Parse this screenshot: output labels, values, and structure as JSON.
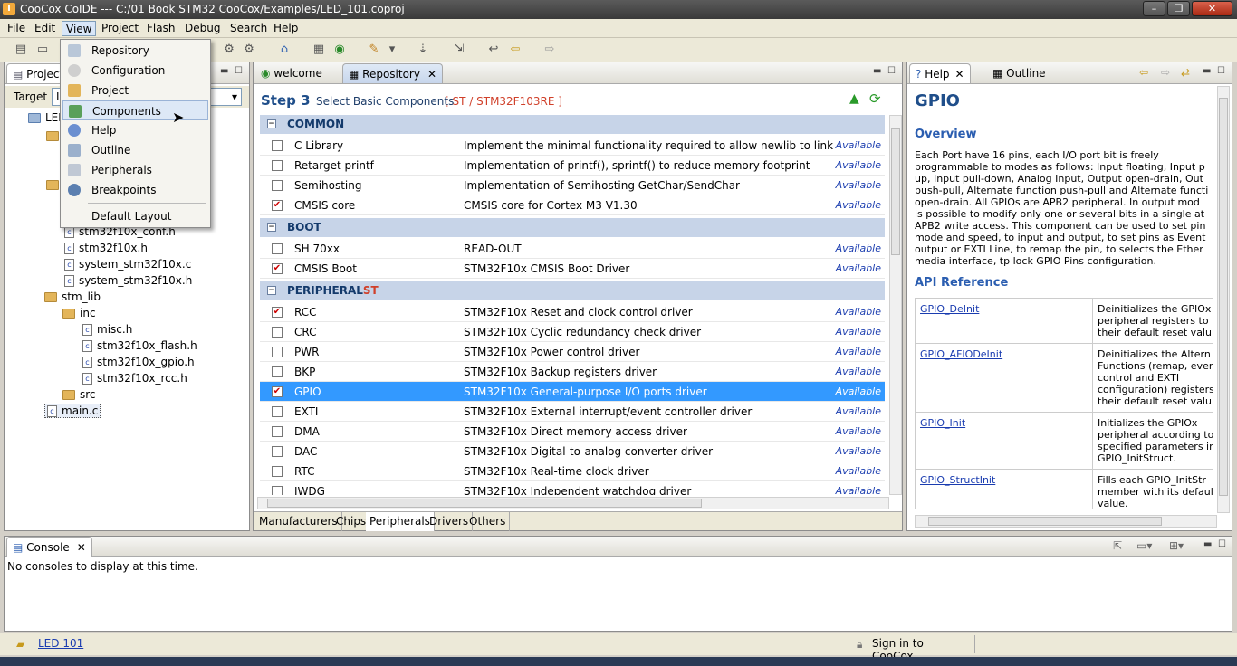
{
  "window": {
    "title": "CooCox CoIDE --- C:/01 Book STM32 CooCox/Examples/LED_101.coproj",
    "app_icon": "I"
  },
  "menubar": [
    "File",
    "Edit",
    "View",
    "Project",
    "Flash",
    "Debug",
    "Search",
    "Help"
  ],
  "view_menu": {
    "items": [
      "Repository",
      "Configuration",
      "Project",
      "Components",
      "Help",
      "Outline",
      "Peripherals",
      "Breakpoints"
    ],
    "default_layout": "Default Layout",
    "highlighted": "Components"
  },
  "project_panel": {
    "tab": "Project",
    "target_label": "Target",
    "target_value": "L",
    "root": "LED",
    "files": [
      {
        "name": "stm32f10x_conf.h",
        "kind": "file"
      },
      {
        "name": "stm32f10x.h",
        "kind": "file"
      },
      {
        "name": "system_stm32f10x.c",
        "kind": "file"
      },
      {
        "name": "system_stm32f10x.h",
        "kind": "file"
      },
      {
        "name": "stm_lib",
        "kind": "folder"
      },
      {
        "name": "inc",
        "kind": "folder"
      },
      {
        "name": "misc.h",
        "kind": "file"
      },
      {
        "name": "stm32f10x_flash.h",
        "kind": "file"
      },
      {
        "name": "stm32f10x_gpio.h",
        "kind": "file"
      },
      {
        "name": "stm32f10x_rcc.h",
        "kind": "file"
      },
      {
        "name": "src",
        "kind": "folder"
      },
      {
        "name": "main.c",
        "kind": "file"
      }
    ]
  },
  "editor": {
    "tabs": [
      "welcome",
      "Repository"
    ],
    "step": {
      "label": "Step 3",
      "text": "Select Basic Components",
      "chip": "[ ST / STM32F103RE ]"
    },
    "sections": [
      {
        "title": "COMMON",
        "suffix": "",
        "rows": [
          {
            "name": "C Library",
            "desc": "Implement the minimal functionality required to allow newlib to link",
            "status": "Available",
            "checked": false
          },
          {
            "name": "Retarget printf",
            "desc": "Implementation of printf(), sprintf() to reduce memory footprint",
            "status": "Available",
            "checked": false
          },
          {
            "name": "Semihosting",
            "desc": "Implementation of Semihosting GetChar/SendChar",
            "status": "Available",
            "checked": false
          },
          {
            "name": "CMSIS core",
            "desc": "CMSIS core for Cortex M3 V1.30",
            "status": "Available",
            "checked": true
          }
        ]
      },
      {
        "title": "BOOT",
        "suffix": "",
        "rows": [
          {
            "name": "SH 70xx",
            "desc": "READ-OUT",
            "status": "Available",
            "checked": false
          },
          {
            "name": "CMSIS Boot",
            "desc": "STM32F10x CMSIS Boot Driver",
            "status": "Available",
            "checked": true
          }
        ]
      },
      {
        "title": "PERIPHERAL",
        "suffix": "ST",
        "rows": [
          {
            "name": "RCC",
            "desc": "STM32F10x Reset and clock control driver",
            "status": "Available",
            "checked": true
          },
          {
            "name": "CRC",
            "desc": "STM32F10x Cyclic redundancy check driver",
            "status": "Available",
            "checked": false
          },
          {
            "name": "PWR",
            "desc": "STM32F10x Power control driver",
            "status": "Available",
            "checked": false
          },
          {
            "name": "BKP",
            "desc": "STM32F10x Backup registers driver",
            "status": "Available",
            "checked": false
          },
          {
            "name": "GPIO",
            "desc": "STM32F10x General-purpose I/O ports driver",
            "status": "Available",
            "checked": true,
            "selected": true
          },
          {
            "name": "EXTI",
            "desc": "STM32F10x External interrupt/event controller driver",
            "status": "Available",
            "checked": false
          },
          {
            "name": "DMA",
            "desc": "STM32F10x Direct memory access driver",
            "status": "Available",
            "checked": false
          },
          {
            "name": "DAC",
            "desc": "STM32F10x Digital-to-analog converter driver",
            "status": "Available",
            "checked": false
          },
          {
            "name": "RTC",
            "desc": "STM32F10x Real-time clock driver",
            "status": "Available",
            "checked": false
          },
          {
            "name": "IWDG",
            "desc": "STM32F10x Independent watchdog driver",
            "status": "Available",
            "checked": false
          }
        ]
      }
    ],
    "bottom_tabs": [
      "Manufacturers",
      "Chips",
      "Peripherals",
      "Drivers",
      "Others"
    ],
    "active_bottom_tab": "Peripherals"
  },
  "help_panel": {
    "tabs": [
      "Help",
      "Outline"
    ],
    "title": "GPIO",
    "overview_heading": "Overview",
    "overview_lines": [
      "Each Port have 16 pins, each I/O port bit is freely",
      "programmable to modes as follows: Input floating, Input p",
      "up, Input pull-down, Analog Input, Output open-drain, Out",
      "push-pull, Alternate function push-pull and Alternate functi",
      "open-drain. All GPIOs are APB2 peripheral. In output mod",
      "is possible to modify only one or several bits in a single at",
      "APB2 write access. This component can be used to set pin",
      "mode and speed, to input and output, to set pins as Event",
      "output or EXTI Line, to remap the pin, to selects the Ether",
      "media interface, tp lock GPIO Pins configuration."
    ],
    "api_heading": "API Reference",
    "api": [
      {
        "fn": "GPIO_DeInit",
        "lines": [
          "Deinitializes the GPIOx",
          "peripheral registers to",
          "their default reset valu"
        ]
      },
      {
        "fn": "GPIO_AFIODeInit",
        "lines": [
          "Deinitializes the Altern",
          "Functions (remap, even",
          "control and EXTI",
          "configuration) registers",
          "their default reset valu"
        ]
      },
      {
        "fn": "GPIO_Init",
        "lines": [
          "Initializes the GPIOx",
          "peripheral according to",
          "specified parameters in",
          "GPIO_InitStruct."
        ]
      },
      {
        "fn": "GPIO_StructInit",
        "lines": [
          "Fills each GPIO_InitStr",
          "member with its defaul",
          "value."
        ]
      }
    ]
  },
  "console": {
    "tab": "Console",
    "message": "No consoles to display at this time."
  },
  "status": {
    "project_link": "LED 101",
    "sign_in": "Sign in to CooCox..."
  },
  "colors": {
    "selection": "#3399ff",
    "section_bg": "#c7d4e8",
    "available": "#1d3fb0",
    "chip_red": "#d0402a"
  }
}
